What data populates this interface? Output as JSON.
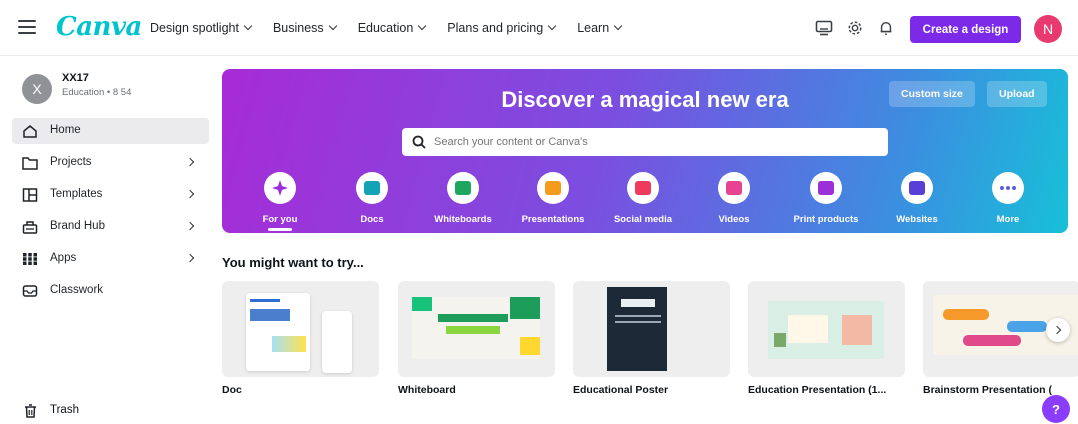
{
  "header": {
    "logo": "Canva",
    "nav": [
      "Design spotlight",
      "Business",
      "Education",
      "Plans and pricing",
      "Learn"
    ],
    "create_label": "Create a design",
    "user_initial": "N"
  },
  "sidebar": {
    "account": {
      "initial": "X",
      "name": "XX17",
      "subtitle": "Education • 8 54"
    },
    "items": [
      {
        "label": "Home",
        "icon": "home-icon"
      },
      {
        "label": "Projects",
        "icon": "folder-icon"
      },
      {
        "label": "Templates",
        "icon": "templates-icon"
      },
      {
        "label": "Brand Hub",
        "icon": "brand-icon"
      },
      {
        "label": "Apps",
        "icon": "apps-grid-icon"
      },
      {
        "label": "Classwork",
        "icon": "classwork-icon"
      }
    ],
    "trash_label": "Trash"
  },
  "hero": {
    "title": "Discover a magical new era",
    "custom_size": "Custom size",
    "upload": "Upload",
    "search_placeholder": "Search your content or Canva's",
    "categories": [
      {
        "label": "For you",
        "color": "#9b30d9"
      },
      {
        "label": "Docs",
        "color": "#13a3b5"
      },
      {
        "label": "Whiteboards",
        "color": "#1ea660"
      },
      {
        "label": "Presentations",
        "color": "#f29b1c"
      },
      {
        "label": "Social media",
        "color": "#ef3a5d"
      },
      {
        "label": "Videos",
        "color": "#e84393"
      },
      {
        "label": "Print products",
        "color": "#9b30d9"
      },
      {
        "label": "Websites",
        "color": "#5a3fd6"
      },
      {
        "label": "More",
        "color": "#5a5fd6"
      }
    ]
  },
  "suggestions": {
    "title": "You might want to try...",
    "cards": [
      {
        "label": "Doc"
      },
      {
        "label": "Whiteboard"
      },
      {
        "label": "Educational Poster"
      },
      {
        "label": "Education Presentation (1..."
      },
      {
        "label": "Brainstorm Presentation ("
      }
    ]
  },
  "help_label": "?"
}
